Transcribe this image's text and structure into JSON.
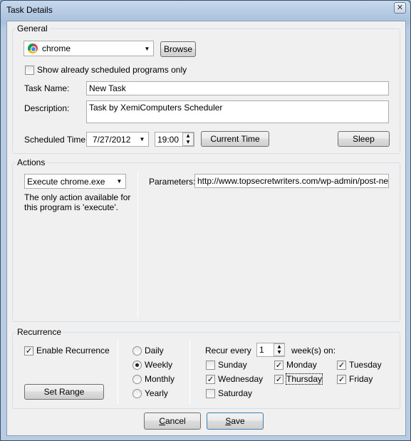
{
  "window": {
    "title": "Task Details",
    "close_glyph": "✕"
  },
  "general": {
    "label": "General",
    "program": "chrome",
    "browse": "Browse",
    "show_scheduled": "Show already scheduled programs only",
    "task_name_label": "Task Name:",
    "task_name": "New Task",
    "description_label": "Description:",
    "description": "Task by XemiComputers Scheduler",
    "scheduled_time_label": "Scheduled Time:",
    "date": "7/27/2012",
    "time": "19:00",
    "current_time": "Current Time",
    "sleep": "Sleep"
  },
  "actions": {
    "label": "Actions",
    "action": "Execute chrome.exe",
    "note": "The only action available for this program is 'execute'.",
    "parameters_label": "Parameters:",
    "parameters": "http://www.topsecretwriters.com/wp-admin/post-new.ph"
  },
  "recurrence": {
    "label": "Recurrence",
    "enable": "Enable Recurrence",
    "enabled": true,
    "set_range": "Set Range",
    "options": [
      "Daily",
      "Weekly",
      "Monthly",
      "Yearly"
    ],
    "selected": "Weekly",
    "recur_every_label": "Recur every",
    "recur_every": "1",
    "weeks_on": "week(s) on:",
    "days": {
      "sunday": {
        "label": "Sunday",
        "checked": false
      },
      "monday": {
        "label": "Monday",
        "checked": true
      },
      "tuesday": {
        "label": "Tuesday",
        "checked": true
      },
      "wednesday": {
        "label": "Wednesday",
        "checked": true
      },
      "thursday": {
        "label": "Thursday",
        "checked": true
      },
      "friday": {
        "label": "Friday",
        "checked": true
      },
      "saturday": {
        "label": "Saturday",
        "checked": false
      }
    }
  },
  "footer": {
    "cancel": "Cancel",
    "save": "Save"
  },
  "glyphs": {
    "check": "✓",
    "dropdown": "▼",
    "up": "▲",
    "down": "▼"
  }
}
